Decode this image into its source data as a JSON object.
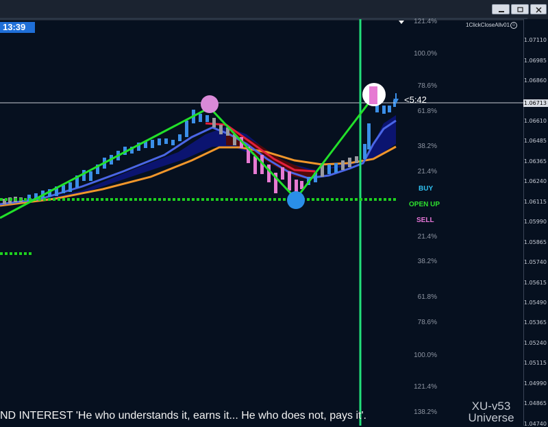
{
  "window": {
    "title_time": "13:39",
    "indicator_name": "1ClickCloseAllv01",
    "controls": [
      "minimize",
      "restore",
      "close"
    ]
  },
  "price_axis": {
    "labels": [
      "1.07110",
      "1.06985",
      "1.06860",
      "1.06713",
      "1.06610",
      "1.06485",
      "1.06365",
      "1.06240",
      "1.06115",
      "1.05990",
      "1.05865",
      "1.05740",
      "1.05615",
      "1.05490",
      "1.05365",
      "1.05240",
      "1.05115",
      "1.04990",
      "1.04865",
      "1.04740"
    ],
    "current_price": "1.06713"
  },
  "fib_levels": [
    "121.4%",
    "100.0%",
    "78.6%",
    "61.8%",
    "38.2%",
    "21.4%",
    "21.4%",
    "38.2%",
    "61.8%",
    "78.6%",
    "100.0%",
    "121.4%",
    "138.2%"
  ],
  "signals": {
    "buy": "BUY",
    "open_up": "OPEN UP",
    "sell": "SELL"
  },
  "countdown": "<5:42",
  "ticker_text": "ND INTEREST  'He who understands it, earns it... He who does not, pays it'.",
  "brand": {
    "line1": "XU-v53",
    "line2": "Universe"
  },
  "colors": {
    "background": "#06101f",
    "bull_candle": "#3b8fe8",
    "bear_candle": "#e67ad2",
    "neutral_candle": "#9a9aa0",
    "zigzag": "#22e02a",
    "support_line": "#1fd11f",
    "buy": "#2fc0f0",
    "open_up": "#2ee02e",
    "sell": "#e676d8"
  }
}
